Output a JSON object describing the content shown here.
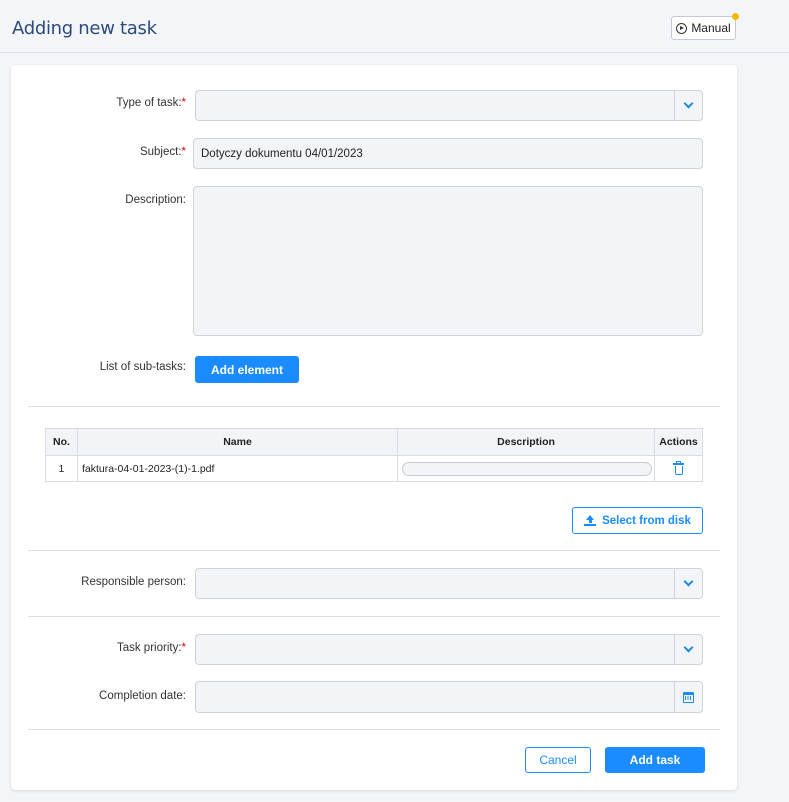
{
  "header": {
    "title": "Adding new task",
    "manual_label": "Manual"
  },
  "form": {
    "type_of_task": {
      "label": "Type of task:",
      "required_mark": "*",
      "value": ""
    },
    "subject": {
      "label": "Subject:",
      "required_mark": "*",
      "value": "Dotyczy dokumentu 04/01/2023"
    },
    "description": {
      "label": "Description:",
      "value": ""
    },
    "subtasks": {
      "label": "List of sub-tasks:",
      "add_button": "Add element"
    },
    "responsible_person": {
      "label": "Responsible person:",
      "value": ""
    },
    "task_priority": {
      "label": "Task priority:",
      "required_mark": "*",
      "value": ""
    },
    "completion_date": {
      "label": "Completion date:",
      "value": ""
    }
  },
  "attachments": {
    "columns": [
      "No.",
      "Name",
      "Description",
      "Actions"
    ],
    "rows": [
      {
        "no": "1",
        "name": "faktura-04-01-2023-(1)-1.pdf",
        "description": "",
        "action": "trash-icon"
      }
    ],
    "select_button": "Select from disk"
  },
  "footer": {
    "cancel_label": "Cancel",
    "submit_label": "Add task"
  },
  "colors": {
    "accent": "#1a8cff",
    "title": "#2c4a7a",
    "required": "#d0021b",
    "notification": "#f5b800"
  }
}
